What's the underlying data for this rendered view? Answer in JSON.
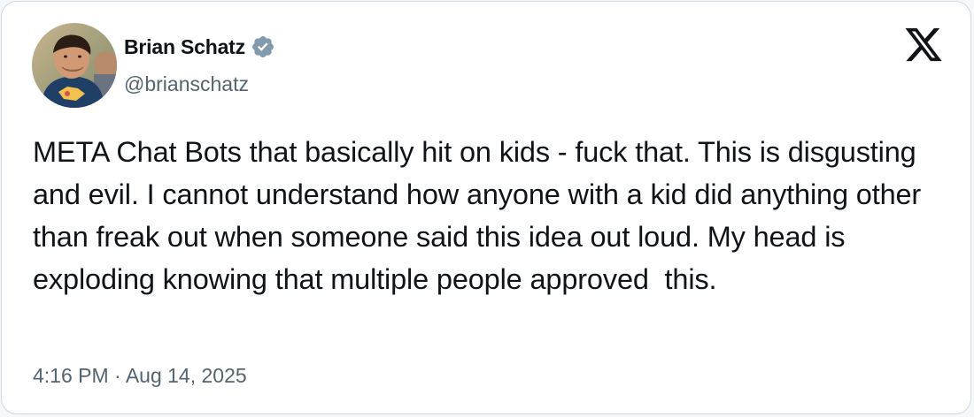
{
  "author": {
    "display_name": "Brian Schatz",
    "handle": "@brianschatz",
    "verified_icon": "verified-badge-icon",
    "avatar": "avatar-photo"
  },
  "platform": {
    "logo_icon": "x-logo-icon"
  },
  "tweet": {
    "text": "META Chat Bots that basically hit on kids - fuck that. This is disgusting and evil. I cannot understand how anyone with a kid did anything other than freak out when someone said this idea out loud. My head is exploding knowing that multiple people approved  this.",
    "timestamp": "4:16 PM · Aug 14, 2025"
  },
  "colors": {
    "text_primary": "#0f1419",
    "text_secondary": "#536471",
    "verified_badge": "#829aab",
    "card_border": "#cfd9de"
  }
}
